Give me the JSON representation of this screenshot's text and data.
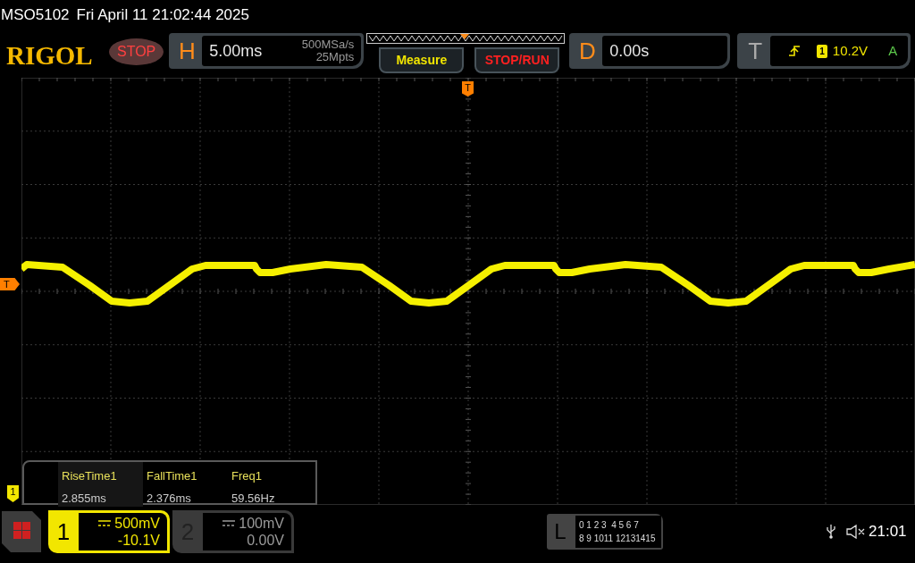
{
  "status_line": {
    "model": "MSO5102",
    "datetime": "Fri April 11 21:02:44 2025"
  },
  "header": {
    "logo": "RIGOL",
    "run_state": "STOP",
    "horizontal": {
      "label": "H",
      "timebase": "5.00ms",
      "sample_rate": "500MSa/s",
      "memory_depth": "25Mpts"
    },
    "buttons": [
      {
        "label": "Measure",
        "kind": "measure"
      },
      {
        "label": "STOP/RUN",
        "kind": "stoprun"
      }
    ],
    "delay": {
      "label": "D",
      "value": "0.00s"
    },
    "trigger": {
      "label": "T",
      "source": "1",
      "level": "10.2V",
      "mode": "A"
    }
  },
  "markers": {
    "trigger_position": "T",
    "trigger_level": "T",
    "channel": "1"
  },
  "measurements": [
    {
      "name": "RiseTime1",
      "value": "2.855ms"
    },
    {
      "name": "FallTime1",
      "value": "2.376ms"
    },
    {
      "name": "Freq1",
      "value": "59.56Hz"
    }
  ],
  "channels": [
    {
      "number": "1",
      "scale": "500mV",
      "offset": "-10.1V",
      "on": true
    },
    {
      "number": "2",
      "scale": "100mV",
      "offset": "0.00V",
      "on": false
    }
  ],
  "logic": {
    "label": "L",
    "rows": [
      "0 1 2 3  4 5 6 7",
      "8 9 1011 12131415"
    ]
  },
  "status_bar": {
    "time": "21:01"
  }
}
